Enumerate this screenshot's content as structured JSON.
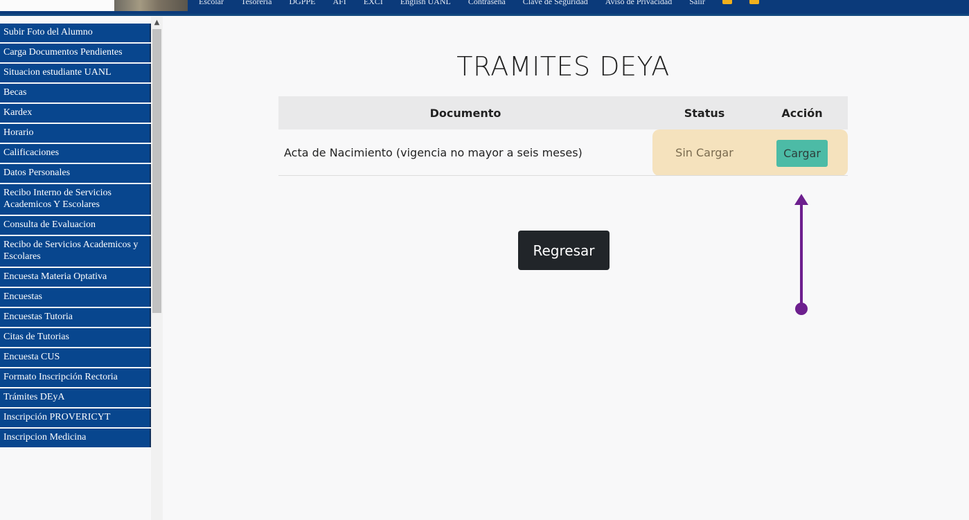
{
  "top_nav": {
    "items": [
      "Escolar",
      "Tesorería",
      "DGPPE",
      "AFI",
      "EXCI",
      "English UANL",
      "Contraseña",
      "Clave de Seguridad",
      "Aviso de Privacidad",
      "Salir"
    ]
  },
  "sidebar": {
    "items": [
      {
        "label": "Subir Foto del Alumno"
      },
      {
        "label": "Carga Documentos Pendientes"
      },
      {
        "label": "Situacion estudiante UANL"
      },
      {
        "label": "Becas"
      },
      {
        "label": "Kardex"
      },
      {
        "label": "Horario"
      },
      {
        "label": "Calificaciones"
      },
      {
        "label": "Datos Personales"
      },
      {
        "label": "Recibo Interno de Servicios Academicos Y Escolares"
      },
      {
        "label": "Consulta de Evaluacion"
      },
      {
        "label": "Recibo de Servicios Academicos y Escolares"
      },
      {
        "label": "Encuesta Materia Optativa"
      },
      {
        "label": "Encuestas"
      },
      {
        "label": "Encuestas Tutoria"
      },
      {
        "label": "Citas de Tutorias"
      },
      {
        "label": "Encuesta CUS"
      },
      {
        "label": "Formato Inscripción Rectoria"
      },
      {
        "label": "Trámites DEyA"
      },
      {
        "label": "Inscripción PROVERICYT"
      },
      {
        "label": "Inscripcion Medicina"
      }
    ]
  },
  "main": {
    "title": "TRAMITES DEYA",
    "table": {
      "headers": {
        "documento": "Documento",
        "status": "Status",
        "accion": "Acción"
      },
      "rows": [
        {
          "documento": "Acta de Nacimiento (vigencia no mayor a seis meses)",
          "status": "Sin Cargar",
          "accion": "Cargar"
        }
      ]
    },
    "back_button": "Regresar"
  },
  "colors": {
    "nav_blue": "#0b3a7a",
    "sidebar_blue": "#08468e",
    "highlight": "#f5e2bd",
    "button_teal": "#4cbba6",
    "annotation_arrow": "#6d1f8e"
  }
}
